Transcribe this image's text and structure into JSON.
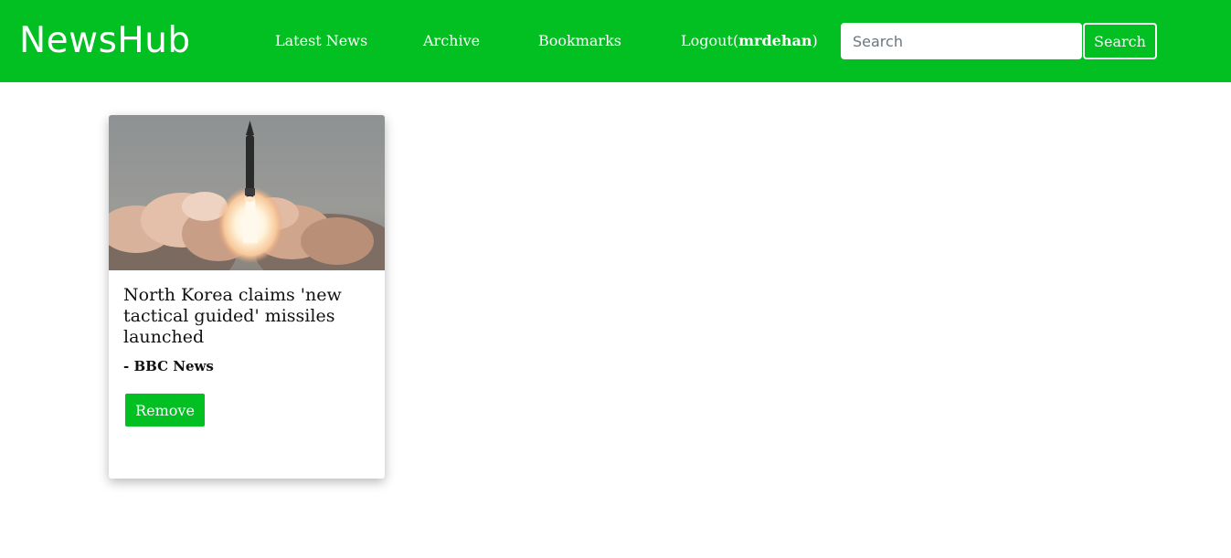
{
  "navbar": {
    "brand": "NewsHub",
    "links": {
      "latest_news": "Latest News",
      "archive": "Archive",
      "bookmarks": "Bookmarks",
      "logout_prefix": "Logout(",
      "logout_user": "mrdehan",
      "logout_suffix": ")"
    },
    "search": {
      "placeholder": "Search",
      "value": "",
      "button_label": "Search"
    }
  },
  "bookmarks": [
    {
      "image": "missile-launch-photo",
      "title": "North Korea claims 'new tactical guided' missiles launched",
      "source": "- BBC News",
      "remove_label": "Remove"
    }
  ],
  "colors": {
    "brand_green": "#02bf22",
    "text": "#111111",
    "background": "#ffffff"
  }
}
